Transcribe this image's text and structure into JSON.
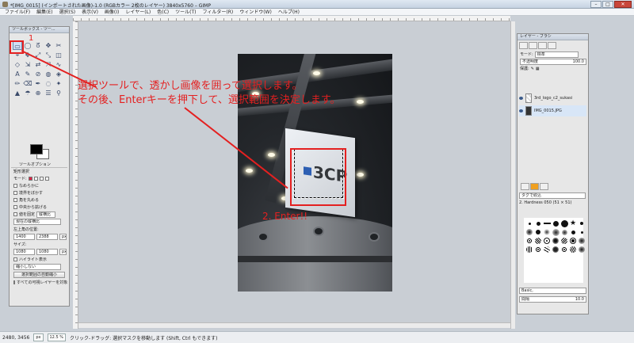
{
  "window": {
    "title": "*[IMG_0015] (インポートされた画像)-1.0 (RGBカラー 2枚のレイヤー) 3840x5760 – GIMP",
    "buttons": [
      "–",
      "□",
      "✕"
    ]
  },
  "menubar": [
    "ファイル(F)",
    "編集(E)",
    "選択(S)",
    "表示(V)",
    "画像(I)",
    "レイヤー(L)",
    "色(C)",
    "ツール(T)",
    "フィルター(R)",
    "ウィンドウ(W)",
    "ヘルプ(H)"
  ],
  "toolbox": {
    "title": "ツールボックス - ツー...",
    "tools": [
      "▭",
      "◯",
      "ᘔ",
      "✥",
      "✂",
      "⌖",
      "✥",
      "⤢",
      "⤡",
      "◫",
      "◇",
      "⇲",
      "⇄",
      "⤧",
      "∿",
      "A",
      "✎",
      "⊘",
      "◍",
      "◈",
      "✏",
      "⌫",
      "✒",
      "◌",
      "✦",
      "▲",
      "☂",
      "⊕",
      "☰",
      "⚲"
    ],
    "options": {
      "tab_label": "ツールオプション",
      "section": "矩形選択",
      "mode_label": "モード:",
      "antialias": "なめらかに",
      "feather": "境界をぼかす",
      "rounded": "角を丸める",
      "expand": "中央から拡げる",
      "fixed": "値を固定",
      "fixed_value": "縦横比",
      "ratio_placeholder": "現在の縦横比",
      "position_label": "左上角の位置:",
      "pos_x": "1400",
      "pos_y": "2388",
      "pos_unit": "px",
      "size_label": "サイズ:",
      "size_w": "1080",
      "size_h": "1080",
      "size_unit": "px",
      "highlight": "ハイライト表示",
      "shrink": "縮小しない",
      "auto_shrink_button": "選択範囲の自動縮小",
      "merged": "すべての可視レイヤーを対象"
    }
  },
  "layers": {
    "title": "レイヤー - ブラシ",
    "mode_label": "モード:",
    "mode_value": "標準",
    "opacity_label": "不透明度",
    "opacity_value": "100.0",
    "lock_label": "保護:",
    "items": [
      {
        "name": "3rd_logo_c2_sukasi",
        "selected": false
      },
      {
        "name": "IMG_0015.JPG",
        "selected": true
      }
    ],
    "brush_filter": "タグで絞込",
    "brush_name": "2. Hardness 050 (51 × 51)",
    "brush_preset": "Basic,",
    "spacing_label": "間隔",
    "spacing_value": "10.0"
  },
  "annotations": {
    "step1": "1",
    "instruction_line1": "選択ツールで、透かし画像を囲って選択します。",
    "instruction_line2": "その後、Enterキーを押下して、選択範囲を決定します。",
    "step2": "2. Enter!!",
    "color": "#e42020"
  },
  "statusbar": {
    "coords": "2480, 3456",
    "unit": "px",
    "zoom": "12.5 %",
    "message": "クリック-ドラッグ: 選択マスクを移動します (Shift, Ctrl もできます)"
  }
}
